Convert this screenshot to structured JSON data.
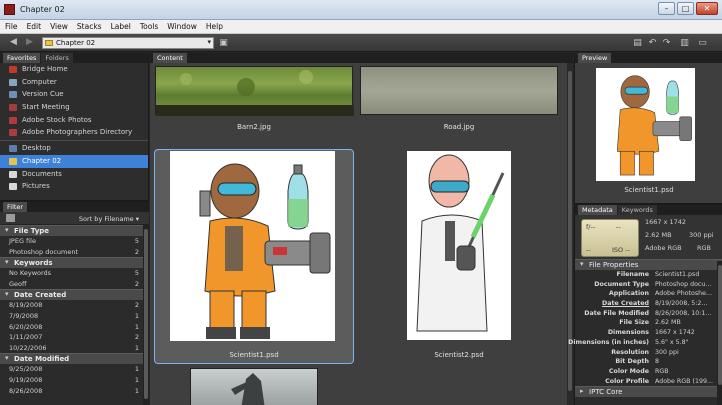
{
  "window": {
    "title": "Chapter 02",
    "min": "–",
    "max": "□",
    "close": "✕"
  },
  "menu": [
    "File",
    "Edit",
    "View",
    "Stacks",
    "Label",
    "Tools",
    "Window",
    "Help"
  ],
  "toolbar": {
    "path": "Chapter 02"
  },
  "favorites": {
    "tabs": [
      "Favorites",
      "Folders"
    ],
    "items": [
      {
        "label": "Bridge Home",
        "color": "#c0392b"
      },
      {
        "label": "Computer",
        "color": "#8aa3bf"
      },
      {
        "label": "Version Cue",
        "color": "#6d8fb8"
      },
      {
        "label": "Start Meeting",
        "color": "#a33d3d"
      },
      {
        "label": "Adobe Stock Photos",
        "color": "#b23a3a"
      },
      {
        "label": "Adobe Photographers Directory",
        "color": "#b23a3a"
      }
    ],
    "places": [
      {
        "label": "Desktop",
        "color": "#5f7fa8"
      },
      {
        "label": "Chapter 02",
        "color": "#e8c24a"
      },
      {
        "label": "Documents",
        "color": "#d9d9d9"
      },
      {
        "label": "Pictures",
        "color": "#d9d9d9"
      }
    ]
  },
  "filter": {
    "tab": "Filter",
    "sort": "Sort by Filename ▾",
    "groups": [
      {
        "title": "File Type",
        "rows": [
          {
            "label": "JPEG file",
            "count": "5"
          },
          {
            "label": "Photoshop document",
            "count": "2"
          }
        ]
      },
      {
        "title": "Keywords",
        "rows": [
          {
            "label": "No Keywords",
            "count": "5"
          },
          {
            "label": "Geoff",
            "count": "2"
          }
        ]
      },
      {
        "title": "Date Created",
        "rows": [
          {
            "label": "8/19/2008",
            "count": "2"
          },
          {
            "label": "7/9/2008",
            "count": "1"
          },
          {
            "label": "6/20/2008",
            "count": "1"
          },
          {
            "label": "1/11/2007",
            "count": "2"
          },
          {
            "label": "10/22/2006",
            "count": "1"
          }
        ]
      },
      {
        "title": "Date Modified",
        "rows": [
          {
            "label": "9/25/2008",
            "count": "1"
          },
          {
            "label": "9/19/2008",
            "count": "1"
          },
          {
            "label": "8/26/2008",
            "count": "1"
          }
        ]
      }
    ]
  },
  "content": {
    "tab": "Content",
    "files": [
      "Barn2.jpg",
      "Road.jpg",
      "Scientist1.psd",
      "Scientist2.psd"
    ]
  },
  "preview": {
    "tab": "Preview",
    "caption": "Scientist1.psd"
  },
  "metadata": {
    "tabs": [
      "Metadata",
      "Keywords"
    ],
    "lcd": {
      "aperture": "f/--",
      "shutter": "--",
      "wb": "--",
      "iso": "ISO --"
    },
    "summary": {
      "dims": "1667 x 1742",
      "size": "2.62 MB",
      "res": "300 ppi",
      "color": "Adobe RGB",
      "mode": "RGB"
    },
    "section": "File Properties",
    "rows": [
      {
        "k": "Filename",
        "v": "Scientist1.psd",
        "u": false
      },
      {
        "k": "Document Type",
        "v": "Photoshop docu...",
        "u": false
      },
      {
        "k": "Application",
        "v": "Adobe Photoshe...",
        "u": false
      },
      {
        "k": "Date Created",
        "v": "8/19/2008, 5:2...",
        "u": true
      },
      {
        "k": "Date File Modified",
        "v": "8/26/2008, 10:1...",
        "u": false
      },
      {
        "k": "File Size",
        "v": "2.62 MB",
        "u": false
      },
      {
        "k": "Dimensions",
        "v": "1667 x 1742",
        "u": false
      },
      {
        "k": "Dimensions (in inches)",
        "v": "5.6\" x 5.8\"",
        "u": false
      },
      {
        "k": "Resolution",
        "v": "300 ppi",
        "u": false
      },
      {
        "k": "Bit Depth",
        "v": "8",
        "u": false
      },
      {
        "k": "Color Mode",
        "v": "RGB",
        "u": false
      },
      {
        "k": "Color Profile",
        "v": "Adobe RGB (199...",
        "u": false
      }
    ],
    "section2": "IPTC Core"
  }
}
